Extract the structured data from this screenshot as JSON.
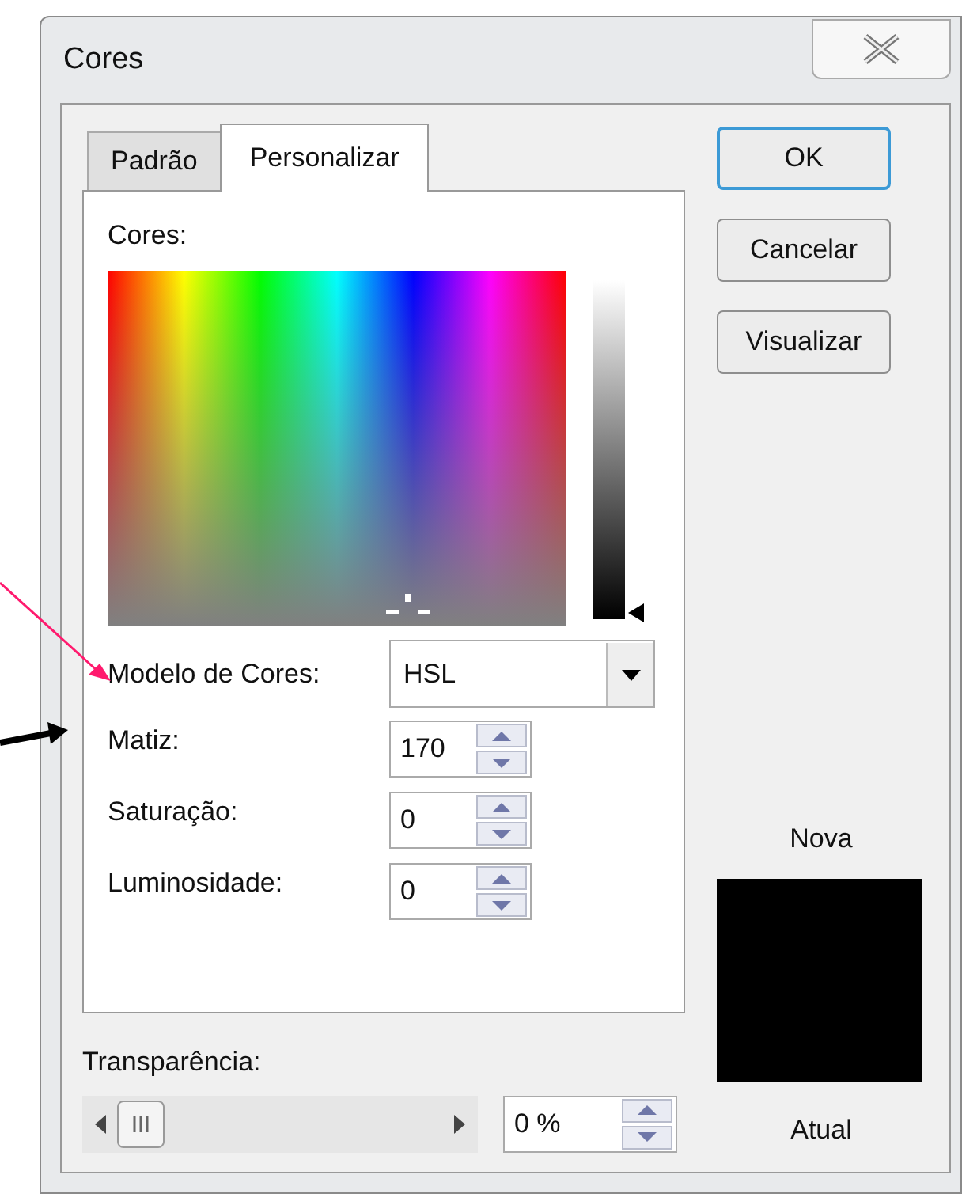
{
  "window": {
    "title": "Cores"
  },
  "tabs": [
    {
      "label": "Padrão",
      "selected": false
    },
    {
      "label": "Personalizar",
      "selected": true
    }
  ],
  "colors_label": "Cores:",
  "luminance_slider": {
    "level": 0
  },
  "color_model": {
    "label": "Modelo de Cores:",
    "value": "HSL"
  },
  "fields": [
    {
      "label": "Matiz:",
      "value": "170"
    },
    {
      "label": "Saturação:",
      "value": "0"
    },
    {
      "label": "Luminosidade:",
      "value": "0"
    }
  ],
  "buttons": [
    {
      "label": "OK",
      "default": true
    },
    {
      "label": "Cancelar",
      "default": false
    },
    {
      "label": "Visualizar",
      "default": false
    }
  ],
  "new_label": "Nova",
  "current_label": "Atual",
  "transparency": {
    "label": "Transparência:",
    "value": "0 %"
  }
}
